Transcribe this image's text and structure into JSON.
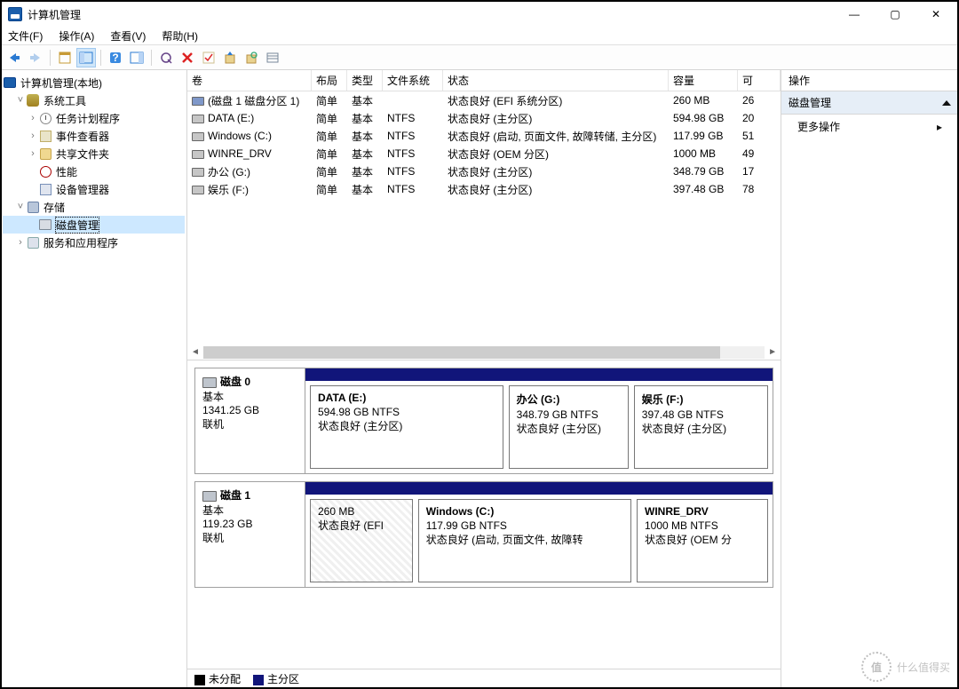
{
  "window": {
    "title": "计算机管理"
  },
  "window_controls": {
    "min": "—",
    "max": "▢",
    "close": "✕"
  },
  "menu": {
    "file": "文件(F)",
    "action": "操作(A)",
    "view": "查看(V)",
    "help": "帮助(H)"
  },
  "tree": {
    "root": "计算机管理(本地)",
    "system_tools": "系统工具",
    "task_scheduler": "任务计划程序",
    "event_viewer": "事件查看器",
    "shared_folders": "共享文件夹",
    "performance": "性能",
    "device_manager": "设备管理器",
    "storage": "存储",
    "disk_mgmt": "磁盘管理",
    "services_apps": "服务和应用程序"
  },
  "grid": {
    "headers": {
      "volume": "卷",
      "layout": "布局",
      "type": "类型",
      "fs": "文件系统",
      "status": "状态",
      "capacity": "容量",
      "free": "可"
    },
    "rows": [
      {
        "volume": "(磁盘 1 磁盘分区 1)",
        "layout": "简单",
        "type": "基本",
        "fs": "",
        "status": "状态良好 (EFI 系统分区)",
        "capacity": "260 MB",
        "free": "26"
      },
      {
        "volume": "DATA (E:)",
        "layout": "简单",
        "type": "基本",
        "fs": "NTFS",
        "status": "状态良好 (主分区)",
        "capacity": "594.98 GB",
        "free": "20"
      },
      {
        "volume": "Windows (C:)",
        "layout": "简单",
        "type": "基本",
        "fs": "NTFS",
        "status": "状态良好 (启动, 页面文件, 故障转储, 主分区)",
        "capacity": "117.99 GB",
        "free": "51"
      },
      {
        "volume": "WINRE_DRV",
        "layout": "简单",
        "type": "基本",
        "fs": "NTFS",
        "status": "状态良好 (OEM 分区)",
        "capacity": "1000 MB",
        "free": "49"
      },
      {
        "volume": "办公 (G:)",
        "layout": "简单",
        "type": "基本",
        "fs": "NTFS",
        "status": "状态良好 (主分区)",
        "capacity": "348.79 GB",
        "free": "17"
      },
      {
        "volume": "娱乐 (F:)",
        "layout": "简单",
        "type": "基本",
        "fs": "NTFS",
        "status": "状态良好 (主分区)",
        "capacity": "397.48 GB",
        "free": "78"
      }
    ]
  },
  "disks": [
    {
      "name": "磁盘 0",
      "type": "基本",
      "size": "1341.25 GB",
      "status": "联机",
      "parts": [
        {
          "label": "DATA  (E:)",
          "line2": "594.98 GB NTFS",
          "line3": "状态良好 (主分区)",
          "flex": 595,
          "hatch": false
        },
        {
          "label": "办公  (G:)",
          "line2": "348.79 GB NTFS",
          "line3": "状态良好 (主分区)",
          "flex": 349,
          "hatch": false
        },
        {
          "label": "娱乐  (F:)",
          "line2": "397.48 GB NTFS",
          "line3": "状态良好 (主分区)",
          "flex": 397,
          "hatch": false
        }
      ]
    },
    {
      "name": "磁盘 1",
      "type": "基本",
      "size": "119.23 GB",
      "status": "联机",
      "parts": [
        {
          "label": "",
          "line2": "260 MB",
          "line3": "状态良好 (EFI",
          "flex": 88,
          "hatch": true
        },
        {
          "label": "Windows  (C:)",
          "line2": "117.99 GB NTFS",
          "line3": "状态良好 (启动, 页面文件, 故障转",
          "flex": 200,
          "hatch": false
        },
        {
          "label": "WINRE_DRV",
          "line2": "1000 MB NTFS",
          "line3": "状态良好 (OEM 分",
          "flex": 117,
          "hatch": false
        }
      ]
    }
  ],
  "legend": {
    "unallocated": "未分配",
    "primary": "主分区"
  },
  "actions": {
    "header": "操作",
    "section": "磁盘管理",
    "more": "更多操作"
  },
  "watermark": {
    "badge": "值",
    "text": "什么值得买"
  }
}
